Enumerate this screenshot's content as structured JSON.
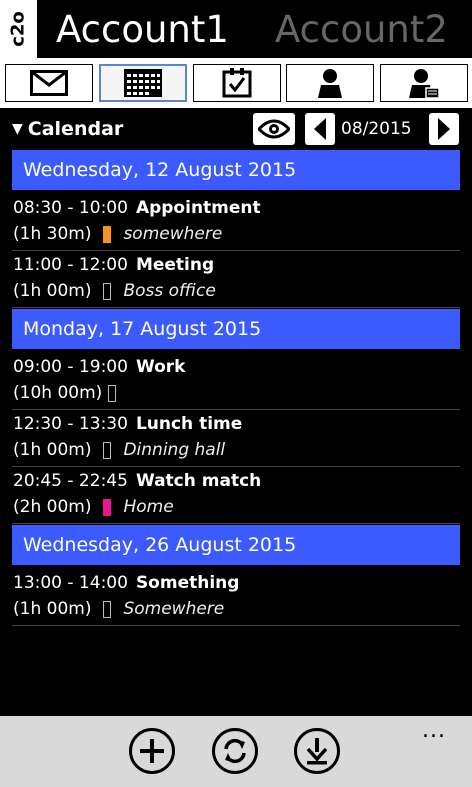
{
  "app": {
    "logo": "c2o",
    "accounts": [
      "Account1",
      "Account2"
    ],
    "active_account": "Account1"
  },
  "toolbar": {
    "buttons": [
      {
        "icon": "mail-icon"
      },
      {
        "icon": "calendar-icon",
        "selected": true
      },
      {
        "icon": "tasks-icon"
      },
      {
        "icon": "contact-icon"
      },
      {
        "icon": "contact-details-icon"
      }
    ]
  },
  "calendar": {
    "title": "Calendar",
    "month": "08/2015"
  },
  "days": [
    {
      "date": "Wednesday, 12 August 2015",
      "events": [
        {
          "time": "08:30 - 10:00",
          "title": "Appointment",
          "duration": "(1h 30m)",
          "location": "somewhere",
          "color": "#f7941d"
        },
        {
          "time": "11:00 - 12:00",
          "title": "Meeting",
          "duration": "(1h 00m)",
          "location": "Boss office",
          "color": ""
        }
      ]
    },
    {
      "date": "Monday, 17 August 2015",
      "events": [
        {
          "time": "09:00 - 19:00",
          "title": "Work",
          "duration": "(10h 00m)",
          "location": "",
          "color": ""
        },
        {
          "time": "12:30 - 13:30",
          "title": "Lunch time",
          "duration": "(1h 00m)",
          "location": "Dinning hall",
          "color": ""
        },
        {
          "time": "20:45 - 22:45",
          "title": "Watch match",
          "duration": "(2h 00m)",
          "location": "Home",
          "color": "#e6198c"
        }
      ]
    },
    {
      "date": "Wednesday, 26 August 2015",
      "events": [
        {
          "time": "13:00 - 14:00",
          "title": "Something",
          "duration": "(1h 00m)",
          "location": "Somewhere",
          "color": ""
        }
      ]
    }
  ],
  "appbar": {
    "buttons": [
      "add-icon",
      "sync-icon",
      "download-icon"
    ],
    "more": "..."
  },
  "colors": {
    "day_header": "#3b5bff",
    "selected_tab_border": "#5b86d6",
    "appbar_bg": "#d9d9d9"
  }
}
